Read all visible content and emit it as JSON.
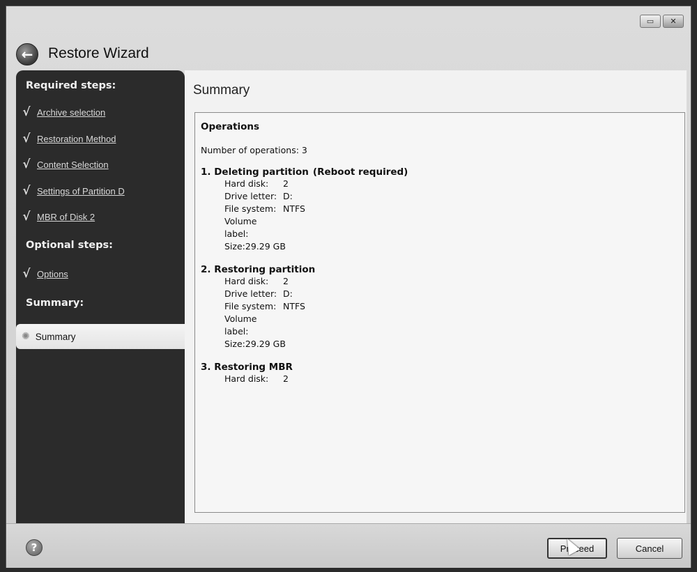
{
  "window": {
    "title": "Restore Wizard",
    "controls": {
      "restore_glyph": "▭",
      "close_glyph": "✕"
    }
  },
  "sidebar": {
    "required_heading": "Required steps:",
    "required_items": [
      {
        "label": "Archive selection"
      },
      {
        "label": "Restoration Method"
      },
      {
        "label": "Content Selection"
      },
      {
        "label": "Settings of Partition D"
      },
      {
        "label": "MBR of Disk 2"
      }
    ],
    "optional_heading": "Optional steps:",
    "optional_items": [
      {
        "label": "Options"
      }
    ],
    "summary_heading": "Summary:",
    "active_item": "Summary"
  },
  "main": {
    "title": "Summary",
    "operations_heading": "Operations",
    "count_text": "Number of operations: 3",
    "operations": [
      {
        "title": "1. Deleting partition",
        "note": "(Reboot required)",
        "fields": {
          "hard_disk_label": "Hard disk:",
          "hard_disk": "2",
          "drive_letter_label": "Drive letter:",
          "drive_letter": "D:",
          "file_system_label": "File system:",
          "file_system": "NTFS",
          "volume_label_label": "Volume label:",
          "volume_label": "",
          "size_label": "Size:",
          "size": "29.29 GB"
        }
      },
      {
        "title": "2. Restoring partition",
        "note": "",
        "fields": {
          "hard_disk_label": "Hard disk:",
          "hard_disk": "2",
          "drive_letter_label": "Drive letter:",
          "drive_letter": "D:",
          "file_system_label": "File system:",
          "file_system": "NTFS",
          "volume_label_label": "Volume label:",
          "volume_label": "",
          "size_label": "Size:",
          "size": "29.29 GB"
        }
      },
      {
        "title": "3. Restoring MBR",
        "note": "",
        "fields": {
          "hard_disk_label": "Hard disk:",
          "hard_disk": "2"
        }
      }
    ]
  },
  "footer": {
    "help_glyph": "?",
    "proceed_label": "Proceed",
    "cancel_label": "Cancel"
  },
  "icons": {
    "back": "back-arrow-icon",
    "check": "checkmark-icon",
    "active": "gear-icon",
    "help": "help-icon"
  }
}
